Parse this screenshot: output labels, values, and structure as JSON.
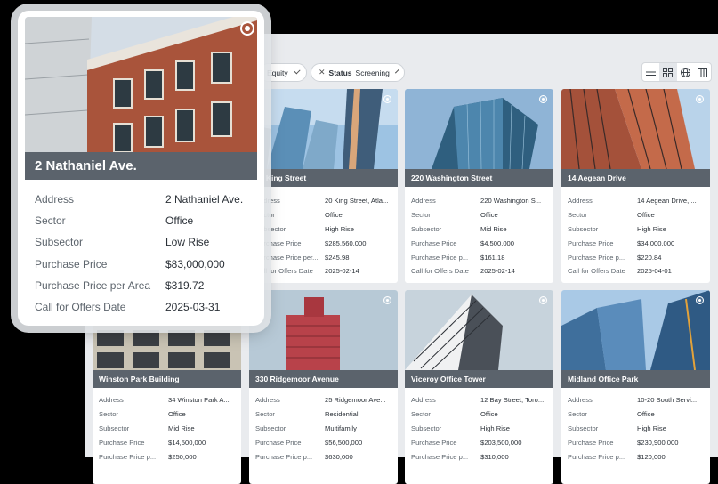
{
  "filters": [
    {
      "label": "",
      "value": "Equity",
      "has_close": false
    },
    {
      "label": "Status",
      "value": "Screening",
      "has_close": true
    }
  ],
  "view_toggles": [
    "list-icon",
    "grid-icon",
    "globe-icon",
    "columns-icon"
  ],
  "active_view": "grid",
  "featured": {
    "name": "2 Nathaniel Ave.",
    "rows": [
      {
        "k": "Address",
        "v": "2 Nathaniel Ave."
      },
      {
        "k": "Sector",
        "v": "Office"
      },
      {
        "k": "Subsector",
        "v": "Low Rise"
      },
      {
        "k": "Purchase Price",
        "v": "$83,000,000"
      },
      {
        "k": "Purchase Price per Area",
        "v": "$319.72"
      },
      {
        "k": "Call for Offers Date",
        "v": "2025-03-31"
      }
    ]
  },
  "cards": [
    {
      "name": "20 King Street",
      "rows": [
        {
          "k": "Address",
          "v": "20 King Street, Atla..."
        },
        {
          "k": "Sector",
          "v": "Office"
        },
        {
          "k": "Subsector",
          "v": "High Rise"
        },
        {
          "k": "Purchase Price",
          "v": "$285,560,000"
        },
        {
          "k": "Purchase Price per...",
          "v": "$245.98"
        },
        {
          "k": "Call for Offers Date",
          "v": "2025-02-14"
        }
      ]
    },
    {
      "name": "220 Washington Street",
      "rows": [
        {
          "k": "Address",
          "v": "220 Washington S..."
        },
        {
          "k": "Sector",
          "v": "Office"
        },
        {
          "k": "Subsector",
          "v": "Mid Rise"
        },
        {
          "k": "Purchase Price",
          "v": "$4,500,000"
        },
        {
          "k": "Purchase Price p...",
          "v": "$161.18"
        },
        {
          "k": "Call for Offers Date",
          "v": "2025-02-14"
        }
      ]
    },
    {
      "name": "14 Aegean Drive",
      "rows": [
        {
          "k": "Address",
          "v": "14 Aegean Drive, ..."
        },
        {
          "k": "Sector",
          "v": "Office"
        },
        {
          "k": "Subsector",
          "v": "High Rise"
        },
        {
          "k": "Purchase Price",
          "v": "$34,000,000"
        },
        {
          "k": "Purchase Price p...",
          "v": "$220.84"
        },
        {
          "k": "Call for Offers Date",
          "v": "2025-04-01"
        }
      ]
    },
    {
      "name": "Winston Park Building",
      "rows": [
        {
          "k": "Address",
          "v": "34 Winston Park A..."
        },
        {
          "k": "Sector",
          "v": "Office"
        },
        {
          "k": "Subsector",
          "v": "Mid Rise"
        },
        {
          "k": "Purchase Price",
          "v": "$14,500,000"
        },
        {
          "k": "Purchase Price p...",
          "v": "$250,000"
        }
      ]
    },
    {
      "name": "330 Ridgemoor Avenue",
      "rows": [
        {
          "k": "Address",
          "v": "25 Ridgemoor Ave..."
        },
        {
          "k": "Sector",
          "v": "Residential"
        },
        {
          "k": "Subsector",
          "v": "Multifamily"
        },
        {
          "k": "Purchase Price",
          "v": "$56,500,000"
        },
        {
          "k": "Purchase Price p...",
          "v": "$630,000"
        }
      ]
    },
    {
      "name": "Viceroy Office Tower",
      "rows": [
        {
          "k": "Address",
          "v": "12 Bay Street, Toro..."
        },
        {
          "k": "Sector",
          "v": "Office"
        },
        {
          "k": "Subsector",
          "v": "High Rise"
        },
        {
          "k": "Purchase Price",
          "v": "$203,500,000"
        },
        {
          "k": "Purchase Price p...",
          "v": "$310,000"
        }
      ]
    },
    {
      "name": "Midland Office Park",
      "rows": [
        {
          "k": "Address",
          "v": "10-20 South Servi..."
        },
        {
          "k": "Sector",
          "v": "Office"
        },
        {
          "k": "Subsector",
          "v": "High Rise"
        },
        {
          "k": "Purchase Price",
          "v": "$230,900,000"
        },
        {
          "k": "Purchase Price p...",
          "v": "$120,000"
        }
      ]
    }
  ]
}
